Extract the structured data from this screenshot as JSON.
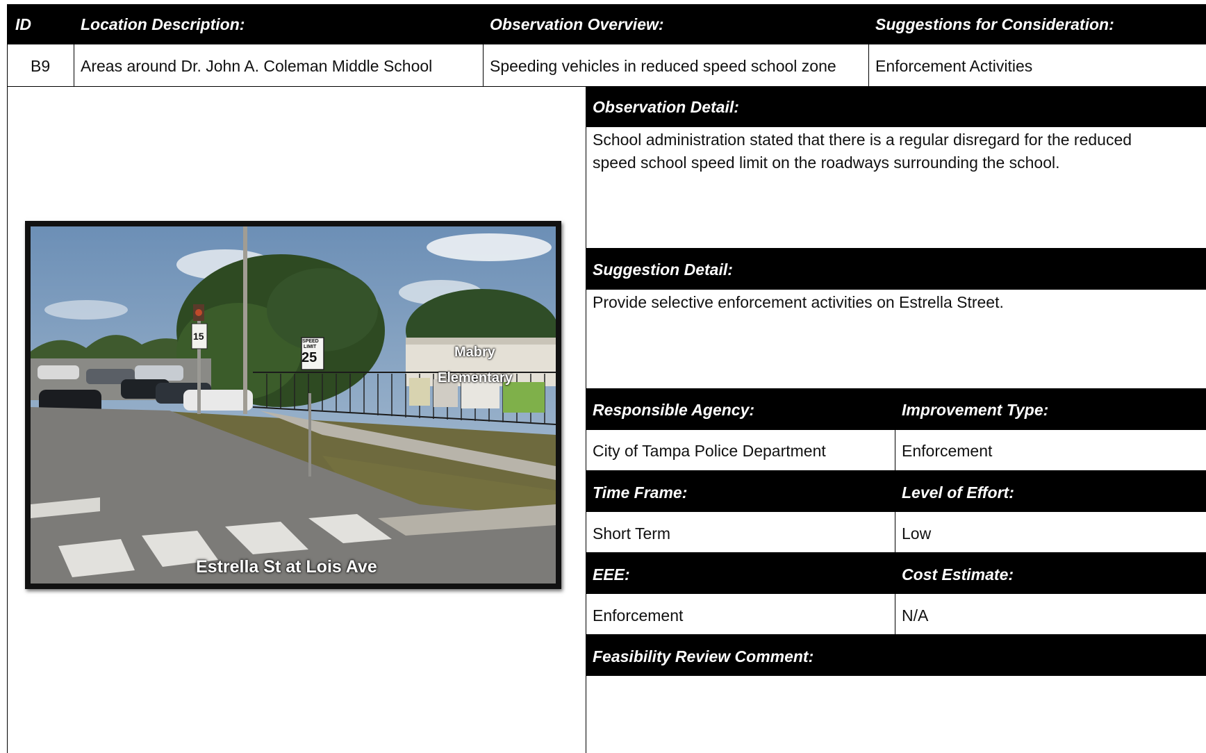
{
  "header": {
    "id": "ID",
    "location": "Location Description:",
    "observation": "Observation Overview:",
    "suggestions": "Suggestions for Consideration:"
  },
  "row": {
    "id": "B9",
    "location": "Areas around Dr. John A. Coleman Middle School",
    "observation": "Speeding vehicles in reduced speed school zone",
    "suggestions": "Enforcement Activities"
  },
  "observation_detail": {
    "heading": "Observation Detail:",
    "line1": "School administration stated that there is a regular disregard for the reduced",
    "line2": "speed school speed limit on the roadways surrounding the school."
  },
  "suggestion_detail": {
    "heading": "Suggestion Detail:",
    "text": "Provide selective enforcement activities on Estrella Street."
  },
  "details": {
    "responsible_agency_label": "Responsible Agency:",
    "improvement_type_label": "Improvement Type:",
    "responsible_agency": "City of Tampa Police Department",
    "improvement_type": "Enforcement",
    "time_frame_label": "Time Frame:",
    "level_of_effort_label": "Level of Effort:",
    "time_frame": "Short Term",
    "level_of_effort": "Low",
    "eee_label": "EEE:",
    "cost_estimate_label": "Cost Estimate:",
    "eee": "Enforcement",
    "cost_estimate": "N/A",
    "feasibility_label": "Feasibility Review Comment:",
    "feasibility": ""
  },
  "photo": {
    "caption": "Estrella St at Lois Ave",
    "label_line1": "Mabry",
    "label_line2": "Elementary",
    "sign1_line1": "SPEED",
    "sign1_line2": "LIMIT",
    "sign1_value": "25",
    "sign2_value": "15"
  }
}
